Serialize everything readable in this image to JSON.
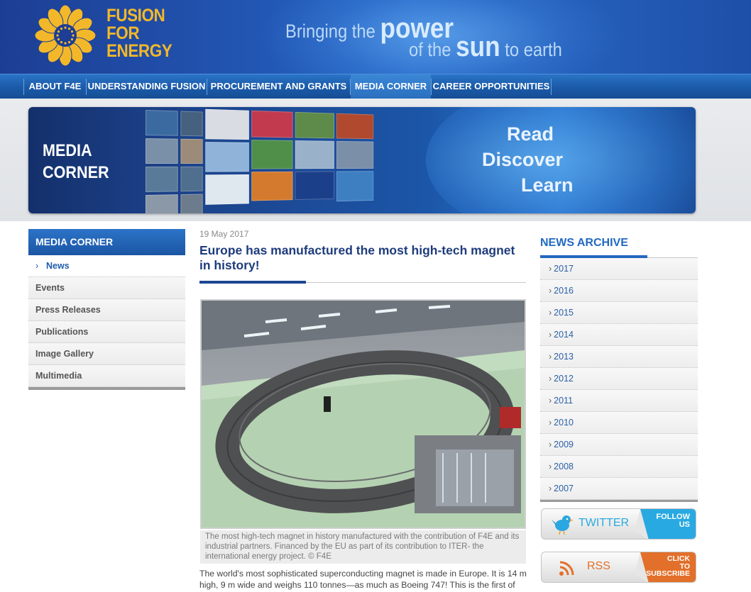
{
  "header": {
    "logo_lines": [
      "FUSION",
      "FOR",
      "ENERGY"
    ],
    "slogan": {
      "w_bringing": "Bringing",
      "w_the": "the",
      "w_power": "power",
      "w_of_the": "of the",
      "w_sun": "sun",
      "w_to_earth": "to earth"
    }
  },
  "nav": {
    "items": [
      {
        "label": "ABOUT F4E"
      },
      {
        "label": "UNDERSTANDING FUSION"
      },
      {
        "label": "PROCUREMENT AND GRANTS"
      },
      {
        "label": "MEDIA CORNER"
      },
      {
        "label": "CAREER OPPORTUNITIES"
      }
    ],
    "active": "MEDIA CORNER"
  },
  "banner": {
    "title_line1": "MEDIA",
    "title_line2": "CORNER",
    "words": [
      "Read",
      "Discover",
      "Learn"
    ]
  },
  "sidebar": {
    "title": "MEDIA CORNER",
    "items": [
      {
        "label": "News"
      },
      {
        "label": "Events"
      },
      {
        "label": "Press Releases"
      },
      {
        "label": "Publications"
      },
      {
        "label": "Image Gallery"
      },
      {
        "label": "Multimedia"
      }
    ],
    "active": "News",
    "chevron": "›"
  },
  "article": {
    "date": "19 May 2017",
    "headline": "Europe has manufactured the most high-tech magnet in history!",
    "caption": "The most high-tech magnet in history manufactured with the contribution of F4E and its industrial partners. Financed by the EU as part of its contribution to ITER- the international energy project. © F4E",
    "body": "The world's most sophisticated superconducting magnet is made in Europe. It is 14 m high, 9 m wide and weighs 110 tonnes—as much as Boeing 747! This is the first of"
  },
  "archive": {
    "title": "NEWS ARCHIVE",
    "chevron": "›",
    "years": [
      "2017",
      "2016",
      "2015",
      "2014",
      "2013",
      "2012",
      "2011",
      "2010",
      "2009",
      "2008",
      "2007"
    ]
  },
  "social": {
    "twitter": {
      "label": "TWITTER",
      "corner_line1": "FOLLOW",
      "corner_line2": "US",
      "icon": "bird-icon"
    },
    "rss": {
      "label": "RSS",
      "corner_line1": "CLICK",
      "corner_line2": "TO",
      "corner_line3": "SUBSCRIBE",
      "icon": "rss-icon"
    }
  },
  "colors": {
    "brand_blue": "#1c56a5",
    "logo_gold": "#f3b82a",
    "headline": "#1e3c7c",
    "twitter": "#29a9e1",
    "rss": "#e2702a"
  }
}
